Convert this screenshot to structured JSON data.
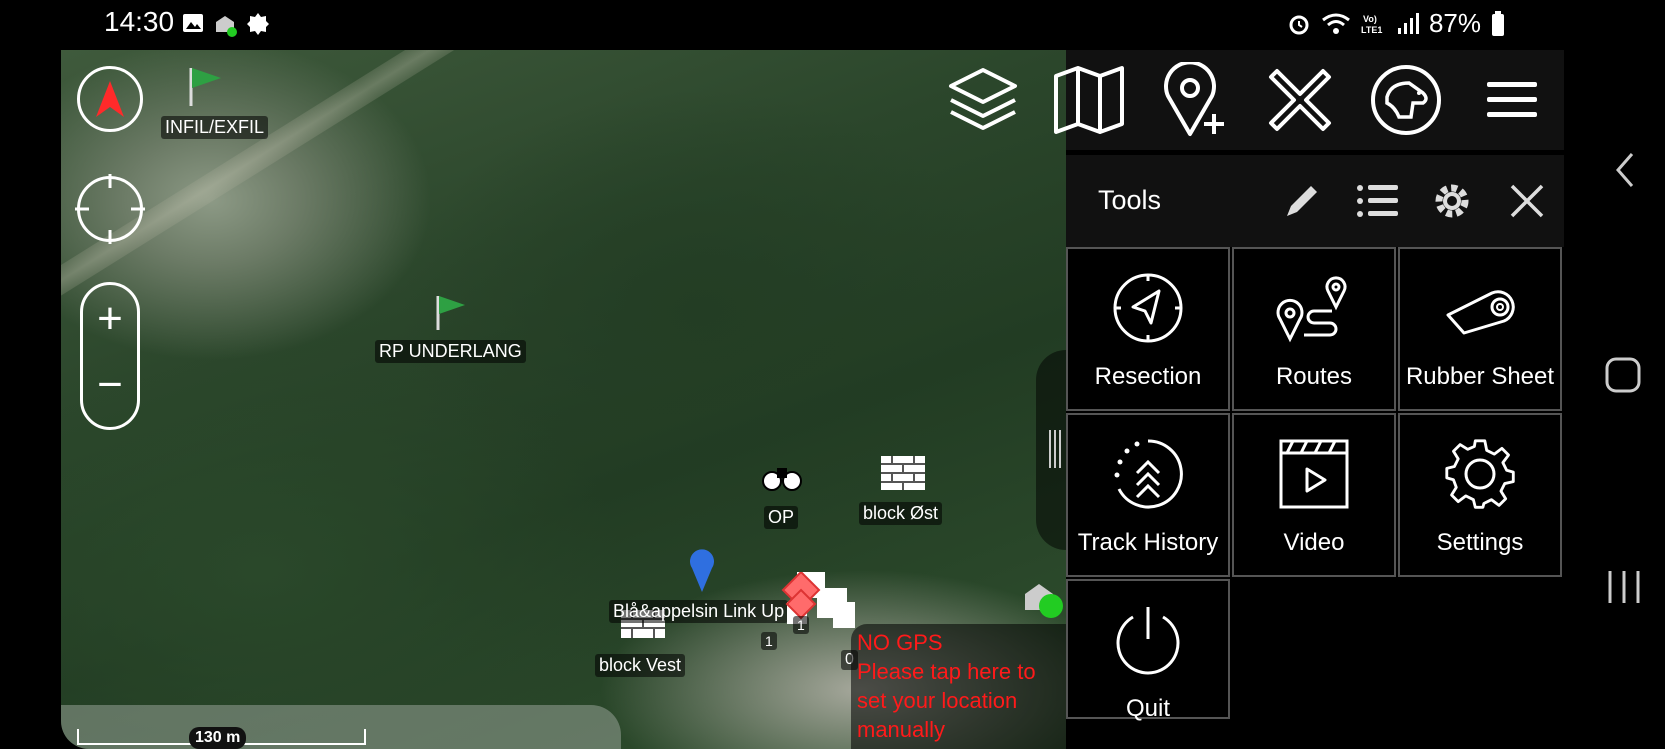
{
  "status_bar": {
    "time": "14:30",
    "battery": "87%",
    "left_icons": [
      "image-icon",
      "app-notification-icon",
      "gear-badge-icon"
    ],
    "right_icons": [
      "alarm-icon",
      "wifi-icon",
      "volte-icon",
      "signal-icon",
      "battery-icon"
    ]
  },
  "map": {
    "markers": [
      {
        "label": "INFIL/EXFIL",
        "icon": "flag-icon"
      },
      {
        "label": "RP UNDERLANG",
        "icon": "flag-icon"
      },
      {
        "label": "OP",
        "icon": "binoculars-icon"
      },
      {
        "label": "block Øst",
        "icon": "wall-icon"
      },
      {
        "label": "block Vest",
        "icon": "wall-icon"
      },
      {
        "label": "Blå&appelsin Link Up",
        "icon": "pin-icon"
      }
    ],
    "cluster_count_a": "1",
    "cluster_count_b": "1",
    "partial_label": "0",
    "scale": "130 m",
    "nogps_title": "NO GPS",
    "nogps_message": "Please tap here to set your location manually",
    "colors": {
      "nogps_text": "#ff1a1a",
      "self_marker": "#22cc22",
      "hostile": "#ff6b6b",
      "flag": "#2ea043"
    }
  },
  "toolbar": {
    "icons": [
      "layers-icon",
      "map-icon",
      "add-pin-icon",
      "close-x-icon",
      "dog-icon",
      "menu-icon"
    ]
  },
  "panel": {
    "title": "Tools",
    "header_icons": [
      "pencil-icon",
      "list-icon",
      "gear-icon",
      "close-icon"
    ],
    "tiles": [
      {
        "label": "Resection",
        "icon": "compass-icon"
      },
      {
        "label": "Routes",
        "icon": "route-icon"
      },
      {
        "label": "Rubber Sheet",
        "icon": "rubber-sheet-icon"
      },
      {
        "label": "Track History",
        "icon": "track-history-icon"
      },
      {
        "label": "Video",
        "icon": "video-icon"
      },
      {
        "label": "Settings",
        "icon": "settings-icon"
      },
      {
        "label": "Quit",
        "icon": "power-icon"
      }
    ]
  },
  "nav": {
    "icons": [
      "back-icon",
      "home-icon",
      "recents-icon"
    ]
  }
}
